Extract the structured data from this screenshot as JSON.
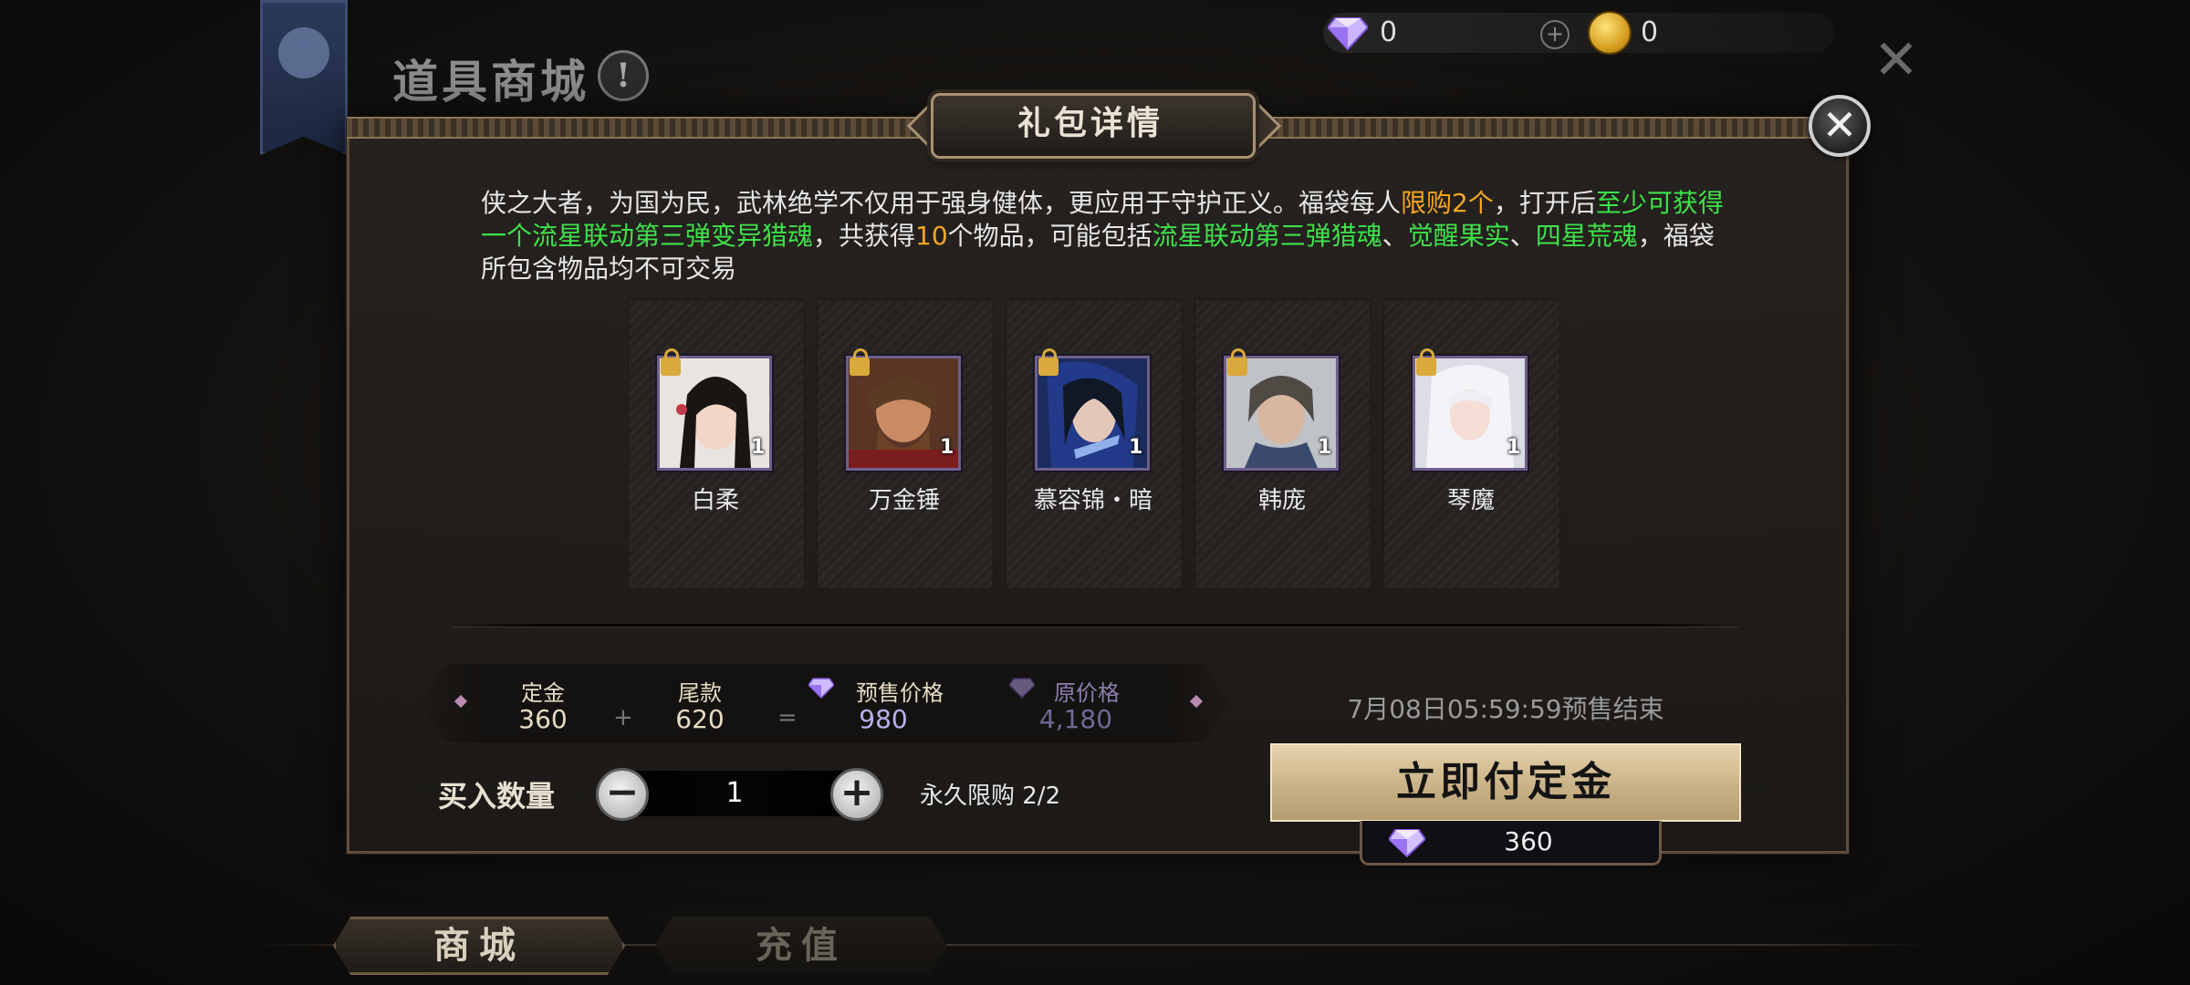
{
  "header": {
    "title": "道具商城",
    "info_symbol": "!",
    "gem_balance": "0",
    "coin_balance": "0"
  },
  "dialog": {
    "title": "礼包详情",
    "description_parts": [
      {
        "text": "侠之大者，为国为民，武林绝学不仅用于强身健体，更应用于守护正义。福袋每人",
        "color": "white"
      },
      {
        "text": "限购2个",
        "color": "orange"
      },
      {
        "text": "，打开后",
        "color": "white"
      },
      {
        "text": "至少可获得一个流星联动第三弹变异猎魂",
        "color": "green"
      },
      {
        "text": "，共获得",
        "color": "white"
      },
      {
        "text": "10",
        "color": "orange"
      },
      {
        "text": "个物品，可能包括",
        "color": "white"
      },
      {
        "text": "流星联动第三弹猎魂",
        "color": "green"
      },
      {
        "text": "、",
        "color": "white"
      },
      {
        "text": "觉醒果实",
        "color": "green"
      },
      {
        "text": "、",
        "color": "white"
      },
      {
        "text": "四星荒魂",
        "color": "green"
      },
      {
        "text": "，福袋所包含物品均不可交易",
        "color": "white"
      }
    ],
    "items": [
      {
        "name": "白柔",
        "qty": "1"
      },
      {
        "name": "万金锤",
        "qty": "1"
      },
      {
        "name": "慕容锦・暗",
        "qty": "1"
      },
      {
        "name": "韩庞",
        "qty": "1"
      },
      {
        "name": "琴魔",
        "qty": "1"
      }
    ],
    "price": {
      "deposit_label": "定金",
      "deposit_value": "360",
      "balance_label": "尾款",
      "balance_value": "620",
      "presale_label": "预售价格",
      "presale_value": "980",
      "original_label": "原价格",
      "original_value": "4,180",
      "plus": "+",
      "equals": "="
    },
    "presale_end": "7月08日05:59:59预售结束",
    "quantity": {
      "label": "买入数量",
      "value": "1",
      "minus": "−",
      "plus": "+",
      "limit": "永久限购 2/2"
    },
    "pay_button": {
      "label": "立即付定金",
      "cost": "360"
    }
  },
  "tabs": [
    {
      "label": "商城",
      "active": true
    },
    {
      "label": "充值",
      "active": false
    }
  ],
  "colors": {
    "orange_highlight": "#f5a623",
    "green_highlight": "#3ee24a",
    "price_purple": "#b9b0f0",
    "gold_button": "#d8c296"
  }
}
